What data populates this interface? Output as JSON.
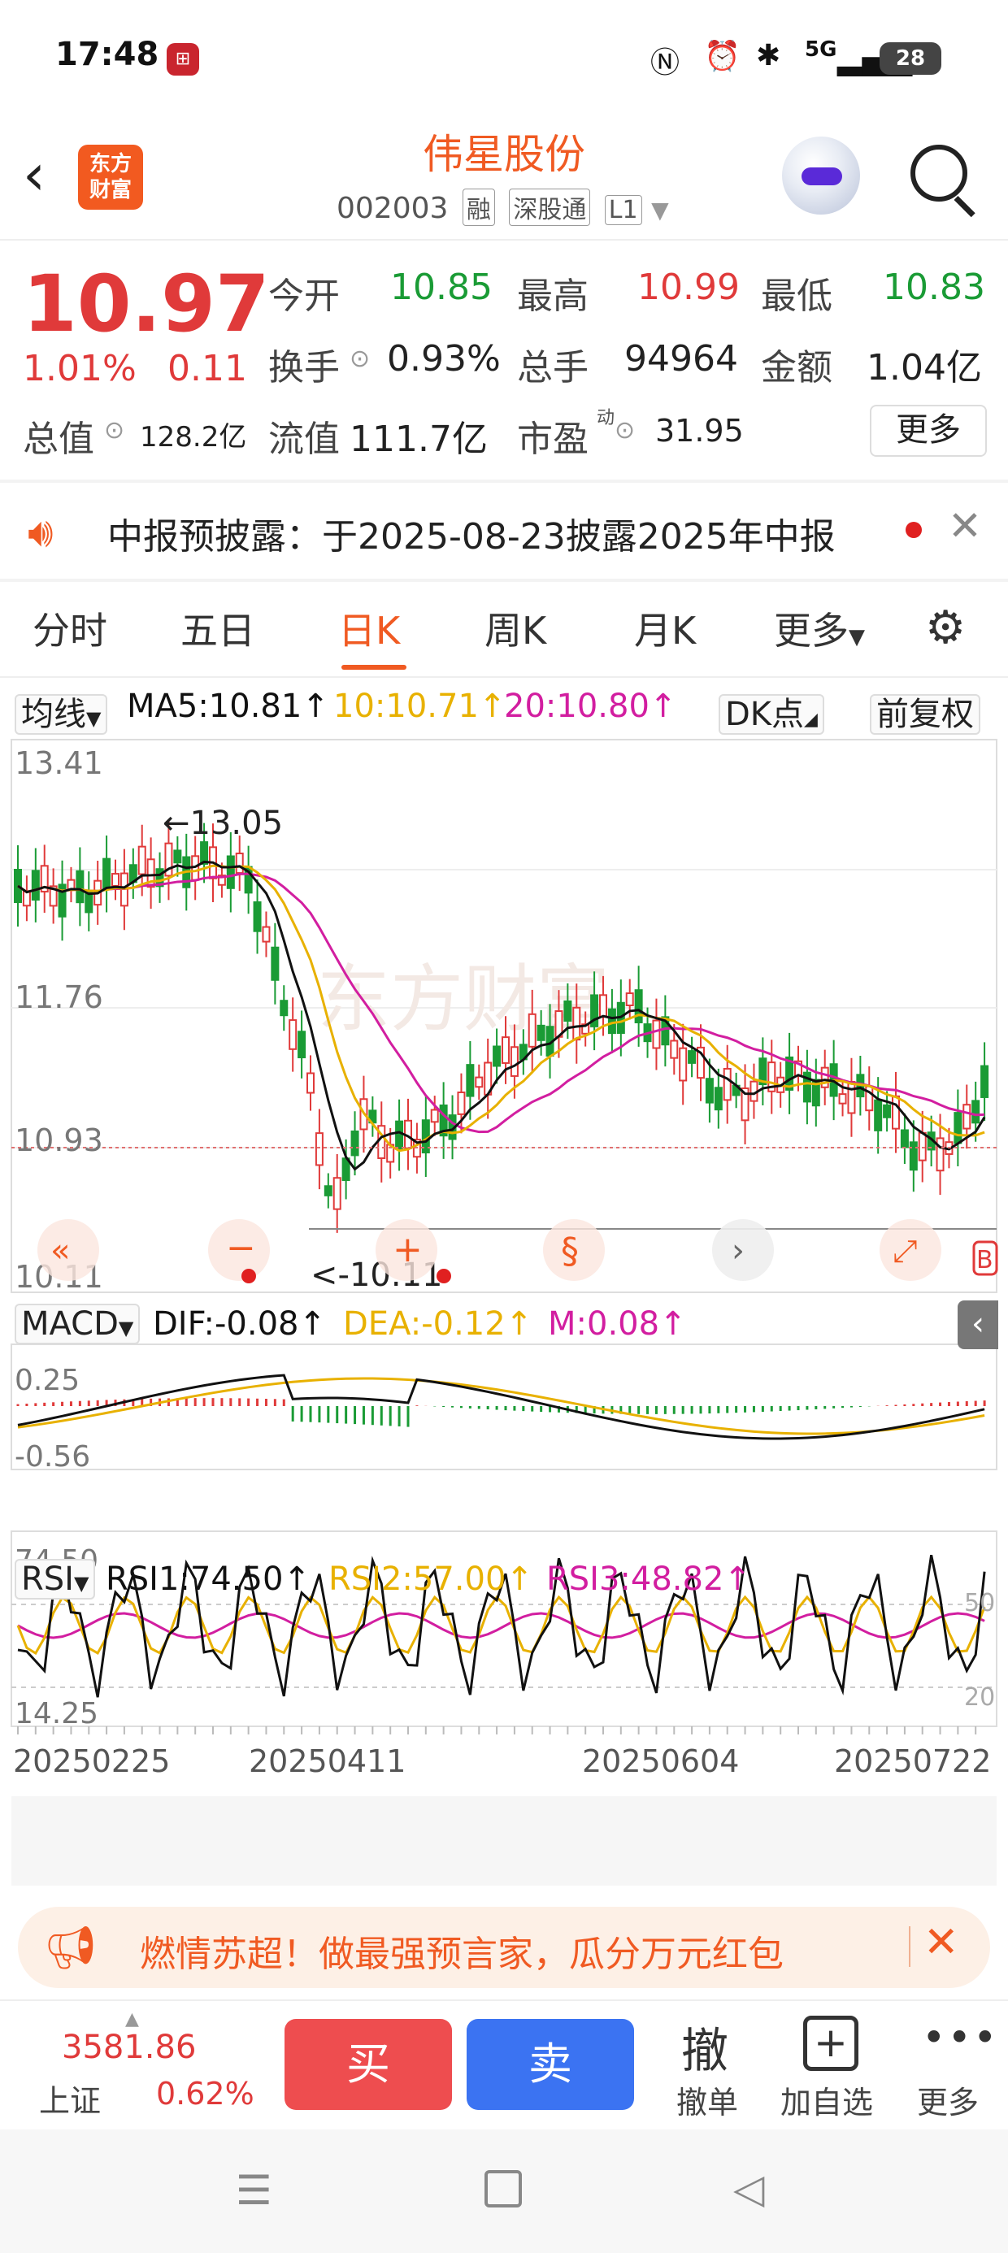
{
  "status_bar": {
    "time": "17:48",
    "battery": "28",
    "network": "5G"
  },
  "header": {
    "title": "伟星股份",
    "code": "002003",
    "tags": [
      "融",
      "深股通",
      "L1"
    ],
    "logo_line1": "东方",
    "logo_line2": "财富"
  },
  "quote": {
    "price": "10.97",
    "change_pct": "1.01%",
    "change": "0.11",
    "open_label": "今开",
    "open": "10.85",
    "high_label": "最高",
    "high": "10.99",
    "low_label": "最低",
    "low": "10.83",
    "turnover_label": "换手",
    "turnover": "0.93%",
    "volume_label": "总手",
    "volume": "94964",
    "amount_label": "金额",
    "amount": "1.04亿",
    "mktcap_label": "总值",
    "mktcap": "128.2亿",
    "float_label": "流值",
    "float": "111.7亿",
    "pe_label": "市盈",
    "pe_sup": "动",
    "pe": "31.95",
    "more_label": "更多"
  },
  "notice": {
    "text": "中报预披露：于2025-08-23披露2025年中报"
  },
  "tabs": [
    {
      "label": "分时"
    },
    {
      "label": "五日"
    },
    {
      "label": "日K"
    },
    {
      "label": "周K"
    },
    {
      "label": "月K"
    },
    {
      "label": "更多"
    }
  ],
  "ma_bar": {
    "selector": "均线",
    "ma5": "MA5:10.81↑",
    "ma10": "10:10.71↑",
    "ma20": "20:10.80↑",
    "dk": "DK点",
    "adjust": "前复权"
  },
  "kchart": {
    "y_labels": [
      "13.41",
      "11.76",
      "10.93",
      "10.11"
    ],
    "high_annot": "←13.05",
    "low_annot": "<-10.11",
    "watermark": "东方财富",
    "buy_mark": "B",
    "colors": {
      "ma5": "#111111",
      "ma10": "#e8b100",
      "ma20": "#d21ea0",
      "up": "#e03a3a",
      "down": "#1a9b35"
    }
  },
  "macd_bar": {
    "selector": "MACD",
    "dif": "DIF:-0.08↑",
    "dea": "DEA:-0.12↑",
    "m": "M:0.08↑",
    "y_top": "0.25",
    "y_bottom": "-0.56"
  },
  "rsi_bar": {
    "selector": "RSI",
    "rsi1": "RSI1:74.50↑",
    "rsi2": "RSI2:57.00↑",
    "rsi3": "RSI3:48.82↑",
    "y_top": "74.50",
    "y_bottom": "14.25",
    "ref50": "50",
    "ref20": "20"
  },
  "x_dates": [
    "20250225",
    "20250411",
    "20250604",
    "20250722"
  ],
  "promo": {
    "text": "燃情苏超！做最强预言家，瓜分万元红包"
  },
  "toolbar": {
    "index_value": "3581.86",
    "index_name": "上证",
    "index_pct": "0.62%",
    "buy": "买",
    "sell": "卖",
    "cancel_icon": "撤",
    "cancel": "撤单",
    "add_fav": "加自选",
    "more": "更多"
  }
}
